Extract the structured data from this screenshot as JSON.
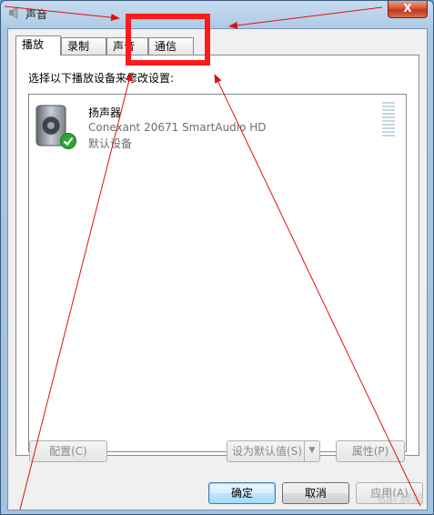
{
  "window": {
    "title": "声音",
    "close_label": "X"
  },
  "tabs": [
    {
      "label": "播放",
      "active": true
    },
    {
      "label": "录制",
      "active": false
    },
    {
      "label": "声音",
      "active": false
    },
    {
      "label": "通信",
      "active": false
    }
  ],
  "instruction": "选择以下播放设备来修改设置:",
  "devices": [
    {
      "name": "扬声器",
      "description": "Conexant 20671 SmartAudio HD",
      "status": "默认设备",
      "icon": "speaker-icon",
      "badge": "check-icon"
    }
  ],
  "buttons": {
    "configure": "配置(C)",
    "set_default": "设为默认值(S)",
    "properties": "属性(P)",
    "ok": "确定",
    "cancel": "取消",
    "apply": "应用(A)"
  },
  "colors": {
    "highlight_box": "#ff1a1a",
    "arrows": "#e01010"
  },
  "watermark": "Bai 经验"
}
